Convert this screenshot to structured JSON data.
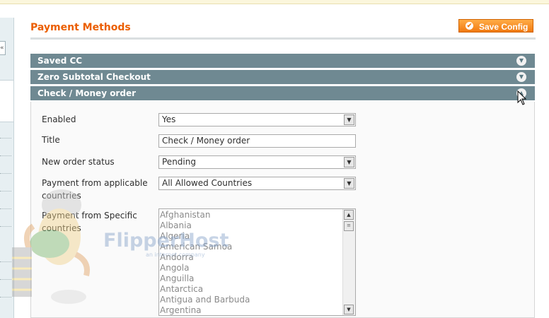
{
  "page": {
    "title": "Payment Methods",
    "save_button": "Save Config"
  },
  "sections": [
    {
      "label": "Saved CC",
      "expanded": false
    },
    {
      "label": "Zero Subtotal Checkout",
      "expanded": false
    },
    {
      "label": "Check / Money order",
      "expanded": true
    }
  ],
  "form": {
    "enabled": {
      "label": "Enabled",
      "value": "Yes"
    },
    "title": {
      "label": "Title",
      "value": "Check / Money order"
    },
    "order_status": {
      "label": "New order status",
      "value": "Pending"
    },
    "applicable": {
      "label_line1": "Payment from applicable",
      "label_line2": "countries",
      "value": "All Allowed Countries"
    },
    "specific": {
      "label_line1": "Payment from Specific",
      "label_line2": "countries",
      "options": [
        "Afghanistan",
        "Albania",
        "Algeria",
        "American Samoa",
        "Andorra",
        "Angola",
        "Anguilla",
        "Antarctica",
        "Antigua and Barbuda",
        "Argentina"
      ]
    }
  },
  "watermark": {
    "text": "FlipperHost",
    "subtitle": "an internet company"
  },
  "colors": {
    "accent": "#eb5e00",
    "section_header": "#6f8992",
    "button": "#f17a10"
  }
}
